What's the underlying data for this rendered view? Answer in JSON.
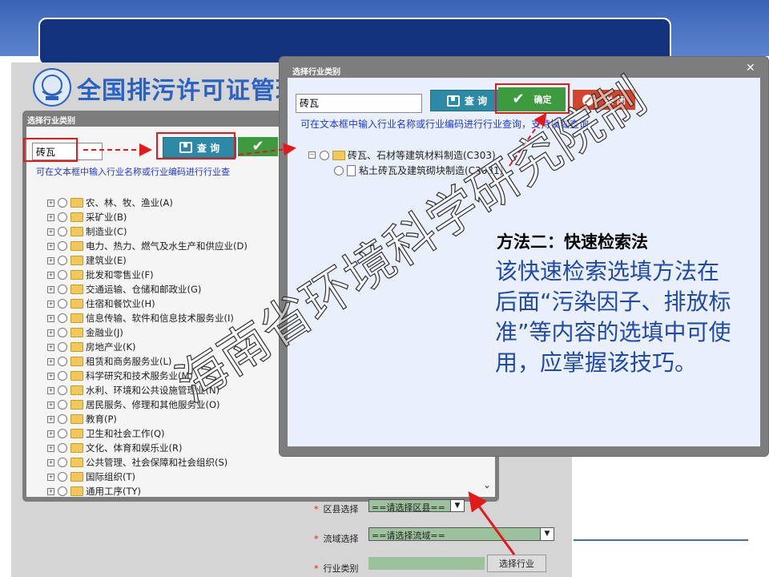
{
  "page": {
    "system_title": "全国排污许可证管理"
  },
  "left_dialog": {
    "title": "选择行业类别",
    "search_value": "砖瓦",
    "query_label": "查 询",
    "hint": "可在文本框中输入行业名称或行业编码进行行业查",
    "tree": [
      "农、林、牧、渔业(A)",
      "采矿业(B)",
      "制造业(C)",
      "电力、热力、燃气及水生产和供应业(D)",
      "建筑业(E)",
      "批发和零售业(F)",
      "交通运输、仓储和邮政业(G)",
      "住宿和餐饮业(H)",
      "信息传输、软件和信息技术服务业(I)",
      "金融业(J)",
      "房地产业(K)",
      "租赁和商务服务业(L)",
      "科学研究和技术服务业(M)",
      "水利、环境和公共设施管理业(N)",
      "居民服务、修理和其他服务业(O)",
      "教育(P)",
      "卫生和社会工作(Q)",
      "文化、体育和娱乐业(R)",
      "公共管理、社会保障和社会组织(S)",
      "国际组织(T)",
      "通用工序(TY)"
    ]
  },
  "form": {
    "district_label": "区县选择",
    "district_value": "==请选择区县==",
    "basin_label": "流域选择",
    "basin_value": "==请选择流域==",
    "industry_label": "行业类别",
    "industry_button": "选择行业"
  },
  "right_dialog": {
    "title": "选择行业类别",
    "close": "✕",
    "search_value": "砖瓦",
    "query_label": "查 询",
    "ok_label": "确定",
    "close_label": "关 闭",
    "hint": "可在文本框中输入行业名称或行业编码进行行业查询，支持模糊查询",
    "tree_parent": "砖瓦、石材等建筑材料制造(C303)",
    "tree_child": "粘土砖瓦及建筑砌块制造(C3031)"
  },
  "annotation": {
    "heading": "方法二：快速检索法",
    "body": "该快速检索选填方法在后面“污染因子、排放标准”等内容的选填中可使用，应掌握该技巧。"
  },
  "watermark": "海南省环境科学研究院制",
  "colors": {
    "accent_blue": "#1f4aa8",
    "highlight_red": "#e21a1a",
    "ok_green": "#3e9a3e",
    "query_teal": "#2d8aa6"
  }
}
